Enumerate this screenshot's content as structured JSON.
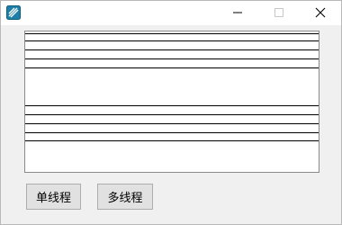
{
  "titlebar": {
    "app_icon": "app-icon",
    "minimize_icon": "minimize-icon",
    "maximize_icon": "maximize-icon",
    "close_icon": "close-icon"
  },
  "buttons": {
    "single_thread": "单线程",
    "multi_thread": "多线程"
  },
  "colors": {
    "window_bg": "#f0f0f0",
    "panel_bg": "#ffffff",
    "button_bg": "#e1e1e1"
  }
}
